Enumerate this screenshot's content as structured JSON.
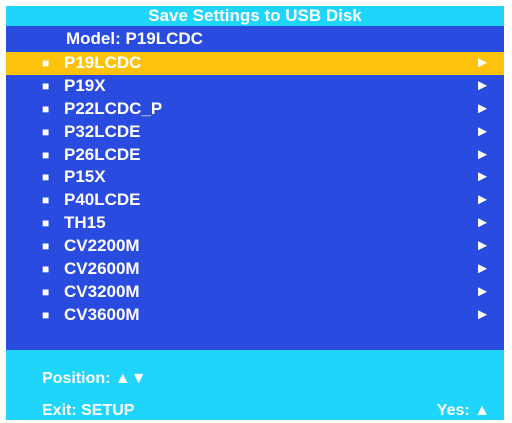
{
  "title": "Save Settings to USB Disk",
  "model_label": "Model: P19LCDC",
  "items": [
    {
      "label": "P19LCDC"
    },
    {
      "label": "P19X"
    },
    {
      "label": "P22LCDC_P"
    },
    {
      "label": "P32LCDE"
    },
    {
      "label": "P26LCDE"
    },
    {
      "label": "P15X"
    },
    {
      "label": "P40LCDE"
    },
    {
      "label": "TH15"
    },
    {
      "label": "CV2200M"
    },
    {
      "label": "CV2600M"
    },
    {
      "label": "CV3200M"
    },
    {
      "label": "CV3600M"
    }
  ],
  "selected_index": 0,
  "bullet_glyph": "■",
  "arrow_glyph": "►",
  "footer": {
    "position": "Position: ▲▼",
    "exit": "Exit: SETUP",
    "yes": "Yes: ▲"
  },
  "colors": {
    "background": "#2a4be0",
    "header_footer": "#1fd5fb",
    "highlight": "#fcc20c",
    "text": "#ffffff"
  }
}
